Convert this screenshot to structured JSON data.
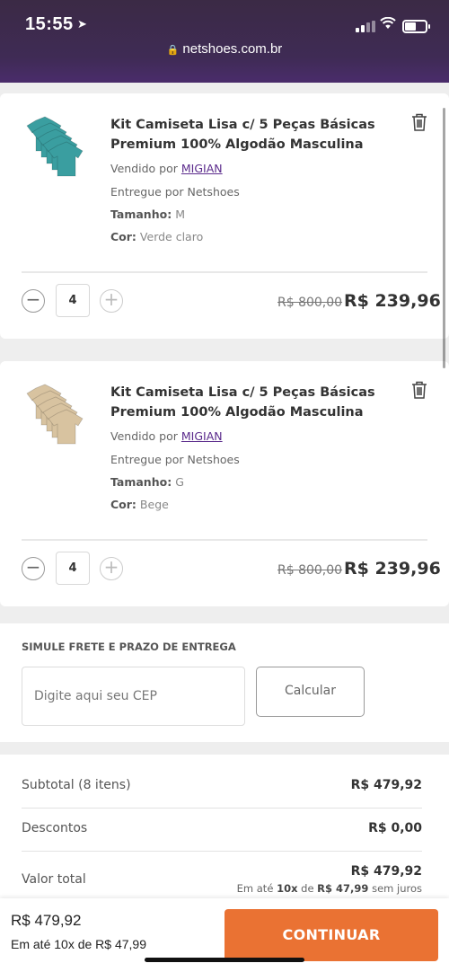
{
  "status_bar": {
    "time": "15:55",
    "location_icon": "location-arrow-icon",
    "url": "netshoes.com.br"
  },
  "cart_items": [
    {
      "title": "Kit Camiseta Lisa c/ 5 Peças Básicas Premium 100% Algodão Masculina",
      "sold_by_label": "Vendido por",
      "seller": "MIGIAN",
      "delivered_by": "Entregue por Netshoes",
      "size_label": "Tamanho:",
      "size": "M",
      "color_label": "Cor:",
      "color": "Verde claro",
      "quantity": "4",
      "old_price": "R$ 800,00",
      "price": "R$ 239,96",
      "shirt_color": "#3a9ea0"
    },
    {
      "title": "Kit Camiseta Lisa c/ 5 Peças Básicas Premium 100% Algodão Masculina",
      "sold_by_label": "Vendido por",
      "seller": "MIGIAN",
      "delivered_by": "Entregue por Netshoes",
      "size_label": "Tamanho:",
      "size": "G",
      "color_label": "Cor:",
      "color": "Bege",
      "quantity": "4",
      "old_price": "R$ 800,00",
      "price": "R$ 239,96",
      "shirt_color": "#d8c3a0"
    }
  ],
  "shipping": {
    "label": "SIMULE FRETE E PRAZO DE ENTREGA",
    "cep_placeholder": "Digite aqui seu CEP",
    "calc_label": "Calcular"
  },
  "summary": {
    "subtotal_label": "Subtotal (8 itens)",
    "subtotal_value": "R$ 479,92",
    "discount_label": "Descontos",
    "discount_value": "R$ 0,00",
    "total_label": "Valor total",
    "total_value": "R$ 479,92",
    "installments_prefix": "Em até",
    "installments_count": "10x",
    "installments_mid": "de",
    "installments_amount": "R$ 47,99",
    "installments_suffix": "sem juros"
  },
  "bottom_bar": {
    "total": "R$ 479,92",
    "installments": "Em até 10x de R$ 47,99",
    "continue_label": "CONTINUAR",
    "accent_color": "#ea7233"
  }
}
